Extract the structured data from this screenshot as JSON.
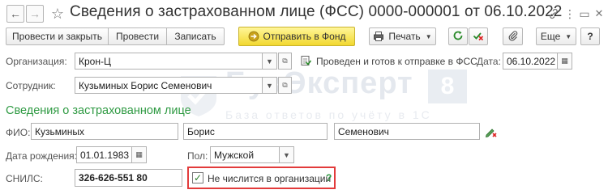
{
  "titlebar": {
    "back_icon": "←",
    "forward_icon": "→",
    "star_icon": "☆",
    "title": "Сведения о застрахованном лице (ФСС) 0000-000001 от 06.10.2022",
    "link_icon": "link-icon",
    "more_icon": "⋮",
    "window_icon": "▭",
    "close_icon": "✕"
  },
  "toolbar": {
    "post_close": "Провести и закрыть",
    "post": "Провести",
    "save": "Записать",
    "send_to_fund": "Отправить в Фонд",
    "print": "Печать",
    "more": "Еще",
    "accent": "#f2d830"
  },
  "form": {
    "org_label": "Организация:",
    "org_value": "Крон-Ц",
    "status_text": "Проведен и готов к отправке в ФСС",
    "date_label": "Дата:",
    "date_value": "06.10.2022",
    "employee_label": "Сотрудник:",
    "employee_value": "Кузьминых Борис Семенович",
    "section_title": "Сведения о застрахованном лице",
    "fio_label": "ФИО:",
    "last_name": "Кузьминых",
    "first_name": "Борис",
    "middle_name": "Семенович",
    "birth_label": "Дата рождения:",
    "birth_value": "01.01.1983",
    "gender_label": "Пол:",
    "gender_value": "Мужской",
    "snils_label": "СНИЛС:",
    "snils_value": "326-626-551 80",
    "not_listed_label": "Не числится в организации",
    "not_listed_checked": true,
    "help_mark": "?"
  },
  "watermark": {
    "brand": "БухЭксперт",
    "badge": "8",
    "tagline": "База ответов по учёту в 1С"
  }
}
